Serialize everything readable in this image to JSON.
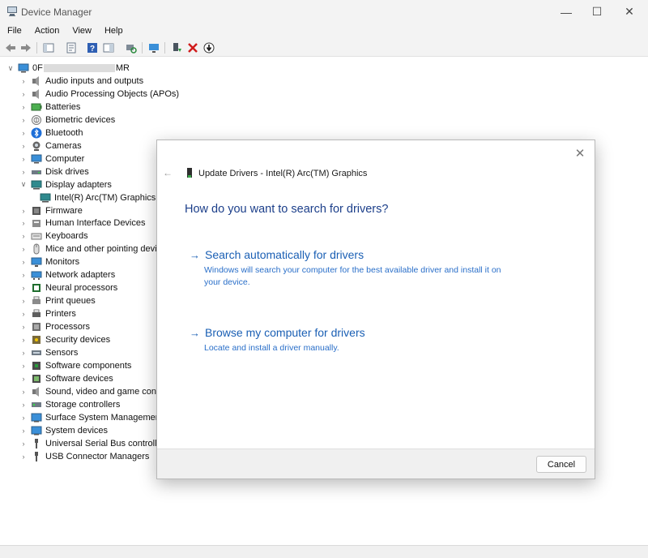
{
  "window": {
    "title": "Device Manager",
    "controls": {
      "minimize": "—",
      "maximize": "☐",
      "close": "✕"
    }
  },
  "menu": [
    "File",
    "Action",
    "View",
    "Help"
  ],
  "toolbar": {
    "icons": [
      "back-arrow-icon",
      "forward-arrow-icon",
      "show-hide-console-tree-icon",
      "properties-icon",
      "help-icon",
      "action-pane-icon",
      "scan-hardware-changes-icon",
      "monitor-icon",
      "update-driver-icon",
      "uninstall-device-icon",
      "disable-device-icon"
    ]
  },
  "tree": {
    "root": {
      "prefix": "0F",
      "suffix": "MR"
    },
    "items": [
      {
        "label": "Audio inputs and outputs",
        "icon": "speaker-icon"
      },
      {
        "label": "Audio Processing Objects (APOs)",
        "icon": "speaker-icon"
      },
      {
        "label": "Batteries",
        "icon": "battery-icon"
      },
      {
        "label": "Biometric devices",
        "icon": "fingerprint-icon"
      },
      {
        "label": "Bluetooth",
        "icon": "bluetooth-icon"
      },
      {
        "label": "Cameras",
        "icon": "camera-icon"
      },
      {
        "label": "Computer",
        "icon": "computer-icon"
      },
      {
        "label": "Disk drives",
        "icon": "disk-drive-icon"
      },
      {
        "label": "Display adapters",
        "icon": "display-adapter-icon",
        "expanded": true
      },
      {
        "label": "Intel(R) Arc(TM) Graphics",
        "icon": "display-adapter-icon",
        "child": true
      },
      {
        "label": "Firmware",
        "icon": "firmware-icon"
      },
      {
        "label": "Human Interface Devices",
        "icon": "hid-icon"
      },
      {
        "label": "Keyboards",
        "icon": "keyboard-icon"
      },
      {
        "label": "Mice and other pointing devices",
        "icon": "mouse-icon"
      },
      {
        "label": "Monitors",
        "icon": "monitor-icon"
      },
      {
        "label": "Network adapters",
        "icon": "network-adapter-icon"
      },
      {
        "label": "Neural processors",
        "icon": "neural-processor-icon"
      },
      {
        "label": "Print queues",
        "icon": "print-queue-icon"
      },
      {
        "label": "Printers",
        "icon": "printer-icon"
      },
      {
        "label": "Processors",
        "icon": "processor-icon"
      },
      {
        "label": "Security devices",
        "icon": "security-device-icon"
      },
      {
        "label": "Sensors",
        "icon": "sensor-icon"
      },
      {
        "label": "Software components",
        "icon": "software-component-icon"
      },
      {
        "label": "Software devices",
        "icon": "software-device-icon"
      },
      {
        "label": "Sound, video and game controllers",
        "icon": "speaker-icon"
      },
      {
        "label": "Storage controllers",
        "icon": "storage-controller-icon"
      },
      {
        "label": "Surface System Management",
        "icon": "system-device-icon"
      },
      {
        "label": "System devices",
        "icon": "system-device-icon"
      },
      {
        "label": "Universal Serial Bus controllers",
        "icon": "usb-icon"
      },
      {
        "label": "USB Connector Managers",
        "icon": "usb-icon"
      }
    ]
  },
  "dialog": {
    "caption": "Update Drivers - Intel(R) Arc(TM) Graphics",
    "heading": "How do you want to search for drivers?",
    "option1": {
      "title": "Search automatically for drivers",
      "description": "Windows will search your computer for the best available driver and install it on your device."
    },
    "option2": {
      "title": "Browse my computer for drivers",
      "description": "Locate and install a driver manually."
    },
    "cancel": "Cancel",
    "back_glyph": "←",
    "arrow_glyph": "→",
    "close_glyph": "✕"
  },
  "colors": {
    "heading": "#1c3f8a",
    "link": "#1a5fb4",
    "chrome": "#f3f3f3"
  }
}
